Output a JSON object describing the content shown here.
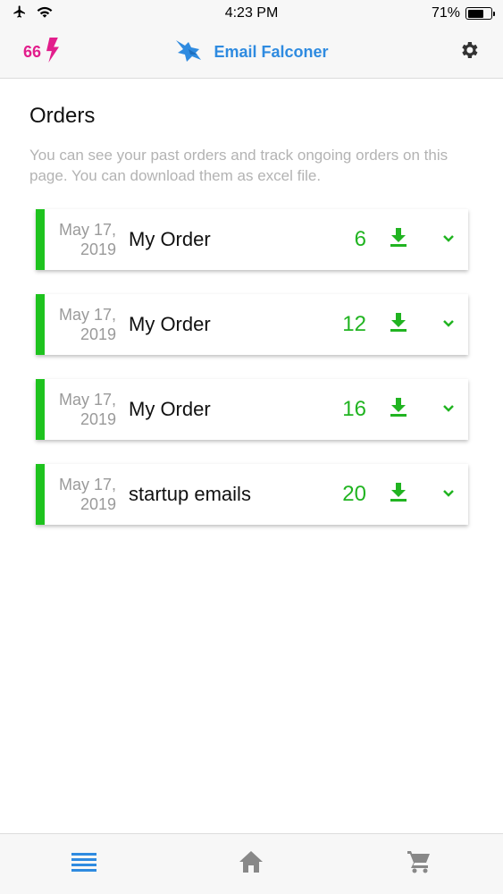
{
  "status_bar": {
    "time": "4:23 PM",
    "battery_percent": "71%",
    "battery_level": 0.71,
    "icons": [
      "airplane-icon",
      "wifi-icon",
      "battery-icon"
    ]
  },
  "header": {
    "credits": "66",
    "credits_icon": "lightning-icon",
    "app_title": "Email Falconer",
    "logo_icon": "falcon-logo-icon",
    "settings_icon": "gear-icon",
    "colors": {
      "credits": "#e21e8c",
      "title": "#2f8be0"
    }
  },
  "page": {
    "title": "Orders",
    "description": "You can see your past orders and track ongoing orders on this page. You can download them as excel file."
  },
  "orders": [
    {
      "date_line1": "May 17,",
      "date_line2": "2019",
      "name": "My Order",
      "count": "6"
    },
    {
      "date_line1": "May 17,",
      "date_line2": "2019",
      "name": "My Order",
      "count": "12"
    },
    {
      "date_line1": "May 17,",
      "date_line2": "2019",
      "name": "My Order",
      "count": "16"
    },
    {
      "date_line1": "May 17,",
      "date_line2": "2019",
      "name": "startup emails",
      "count": "20"
    }
  ],
  "accent_color": "#1ec31e",
  "tab_bar": {
    "tabs": [
      {
        "icon": "list-icon",
        "active": true
      },
      {
        "icon": "home-icon",
        "active": false
      },
      {
        "icon": "cart-icon",
        "active": false
      }
    ],
    "active_color": "#2f8be0",
    "inactive_color": "#888888"
  }
}
